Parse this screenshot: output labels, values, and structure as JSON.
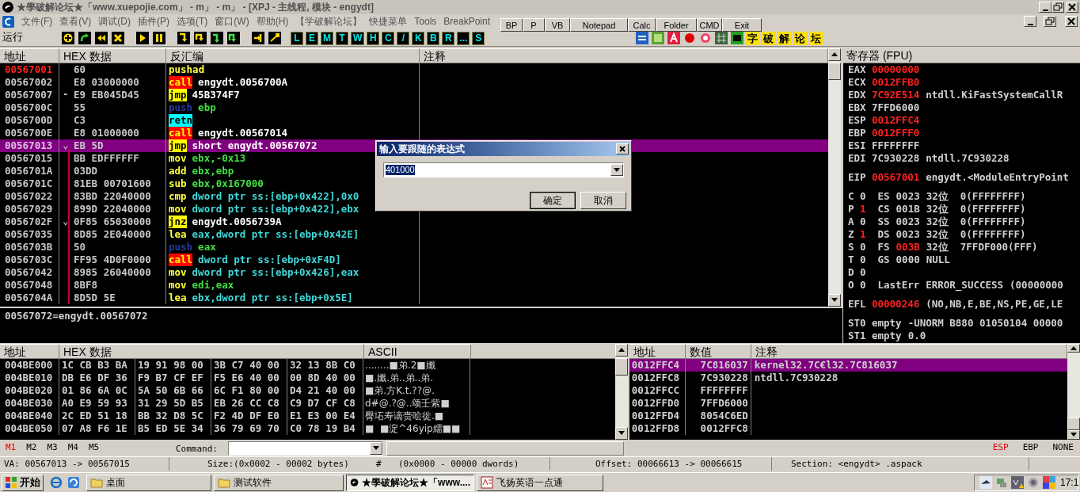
{
  "title_bar": {
    "title": "★學破解论坛★「www.xuepojie.com」 - m」 - m」 - [XPJ - 主线程, 模块 - engydt]"
  },
  "menu": [
    "文件(F)",
    "查看(V)",
    "调试(D)",
    "插件(P)",
    "选项(T)",
    "窗口(W)",
    "帮助(H)",
    "【学破解论坛】",
    "快捷菜单",
    "Tools",
    "BreakPoint"
  ],
  "quick_buttons": [
    "BP",
    "P",
    "VB",
    "Notepad",
    "Calc",
    "Folder",
    "CMD",
    "Exit"
  ],
  "toolbar": {
    "status": "运行",
    "letter_buttons": [
      "L",
      "E",
      "M",
      "T",
      "W",
      "H",
      "C",
      "/",
      "K",
      "B",
      "R",
      "...",
      "S"
    ],
    "text_buttons": [
      "字",
      "破",
      "解",
      "论",
      "坛"
    ]
  },
  "disassembly": {
    "columns": [
      "地址",
      "HEX 数据",
      "反汇编",
      "注释"
    ],
    "rows": [
      {
        "address": "00567001",
        "hex": "60",
        "mnemonic": "pushad",
        "kind": "plain",
        "current": true,
        "selected": false,
        "jump_line": false
      },
      {
        "address": "00567002",
        "hex": "E8 03000000",
        "mnemonic": "call",
        "kind": "call",
        "operands": {
          "text": "engydt.0056700A",
          "kind": "label"
        },
        "current": false,
        "selected": false,
        "jump_line": false
      },
      {
        "address": "00567007",
        "marker": "-",
        "hex": "E9 EB045D45",
        "mnemonic": "jmp",
        "kind": "jump",
        "operands": {
          "text": "45B374F7",
          "kind": "label"
        },
        "current": false,
        "selected": false,
        "jump_line": false
      },
      {
        "address": "0056700C",
        "hex": "55",
        "mnemonic": "push",
        "kind": "push",
        "operands": {
          "text": "ebp",
          "kind": "reg"
        },
        "current": false,
        "selected": false,
        "jump_line": false
      },
      {
        "address": "0056700D",
        "hex": "C3",
        "mnemonic": "retn",
        "kind": "ret",
        "current": false,
        "selected": false,
        "jump_line": false
      },
      {
        "address": "0056700E",
        "hex": "E8 01000000",
        "mnemonic": "call",
        "kind": "call",
        "operands": {
          "text": "engydt.00567014",
          "kind": "label"
        },
        "current": false,
        "selected": false,
        "jump_line": false
      },
      {
        "address": "00567013",
        "marker": "⌄",
        "hex": "EB 5D",
        "mnemonic": "jmp",
        "kind": "jump",
        "operands": {
          "text": "short engydt.00567072",
          "kind": "label"
        },
        "current": false,
        "selected": true,
        "jump_line": true
      },
      {
        "address": "00567015",
        "hex": "BB EDFFFFFF",
        "mnemonic": "mov",
        "kind": "plain",
        "operands": {
          "text": "ebx,-0x13",
          "kind": "reg"
        },
        "current": false,
        "selected": false,
        "jump_line": false
      },
      {
        "address": "0056701A",
        "hex": "03DD",
        "mnemonic": "add",
        "kind": "plain",
        "operands": {
          "text": "ebx,ebp",
          "kind": "reg"
        },
        "current": false,
        "selected": false,
        "jump_line": false
      },
      {
        "address": "0056701C",
        "hex": "81EB 00701600",
        "mnemonic": "sub",
        "kind": "plain",
        "operands": {
          "text": "ebx,0x167000",
          "kind": "reg"
        },
        "current": false,
        "selected": false,
        "jump_line": false
      },
      {
        "address": "00567022",
        "hex": "83BD 22040000",
        "mnemonic": "cmp",
        "kind": "plain",
        "operands": {
          "text": "dword ptr ss:[ebp+0x422],0x0",
          "kind": "mem"
        },
        "current": false,
        "selected": false,
        "jump_line": false
      },
      {
        "address": "00567029",
        "hex": "899D 22040000",
        "mnemonic": "mov",
        "kind": "plain",
        "operands": {
          "text": "dword ptr ss:[ebp+0x422],ebx",
          "kind": "mem"
        },
        "current": false,
        "selected": false,
        "jump_line": false
      },
      {
        "address": "0056702F",
        "marker": "⌄",
        "hex": "0F85 65030000",
        "mnemonic": "jnz",
        "kind": "jump",
        "operands": {
          "text": "engydt.0056739A",
          "kind": "label"
        },
        "current": false,
        "selected": false,
        "jump_line": false
      },
      {
        "address": "00567035",
        "hex": "8D85 2E040000",
        "mnemonic": "lea",
        "kind": "plain",
        "operands": {
          "text": "eax,dword ptr ss:[ebp+0x42E]",
          "kind": "mem"
        },
        "current": false,
        "selected": false,
        "jump_line": false
      },
      {
        "address": "0056703B",
        "hex": "50",
        "mnemonic": "push",
        "kind": "push",
        "operands": {
          "text": "eax",
          "kind": "reg"
        },
        "current": false,
        "selected": false,
        "jump_line": false
      },
      {
        "address": "0056703C",
        "hex": "FF95 4D0F0000",
        "mnemonic": "call",
        "kind": "call",
        "operands": {
          "text": "dword ptr ss:[ebp+0xF4D]",
          "kind": "mem"
        },
        "current": false,
        "selected": false,
        "jump_line": false
      },
      {
        "address": "00567042",
        "hex": "8985 26040000",
        "mnemonic": "mov",
        "kind": "plain",
        "operands": {
          "text": "dword ptr ss:[ebp+0x426],eax",
          "kind": "mem"
        },
        "current": false,
        "selected": false,
        "jump_line": false
      },
      {
        "address": "00567048",
        "hex": "8BF8",
        "mnemonic": "mov",
        "kind": "plain",
        "operands": {
          "text": "edi,eax",
          "kind": "reg"
        },
        "current": false,
        "selected": false,
        "jump_line": false
      },
      {
        "address": "0056704A",
        "hex": "8D5D 5E",
        "mnemonic": "lea",
        "kind": "plain",
        "operands": {
          "text": "ebx,dword ptr ss:[ebp+0x5E]",
          "kind": "mem"
        },
        "current": false,
        "selected": false,
        "jump_line": false
      }
    ]
  },
  "info_line": "00567072=engydt.00567072",
  "registers": {
    "title": "寄存器 (FPU)",
    "groups": [
      [
        {
          "kind": "reg",
          "name": "EAX",
          "value": "00000000",
          "changed": true
        },
        {
          "kind": "reg",
          "name": "ECX",
          "value": "0012FFB0",
          "changed": true
        },
        {
          "kind": "reg",
          "name": "EDX",
          "value": "7C92E514",
          "changed": true,
          "comment": "ntdll.KiFastSystemCallR"
        },
        {
          "kind": "reg",
          "name": "EBX",
          "value": "7FFD6000",
          "changed": false
        },
        {
          "kind": "reg",
          "name": "ESP",
          "value": "0012FFC4",
          "changed": true
        },
        {
          "kind": "reg",
          "name": "EBP",
          "value": "0012FFF0",
          "changed": true
        },
        {
          "kind": "reg",
          "name": "ESI",
          "value": "FFFFFFFF",
          "changed": false
        },
        {
          "kind": "reg",
          "name": "EDI",
          "value": "7C930228",
          "changed": false,
          "comment": "ntdll.7C930228"
        }
      ],
      [
        {
          "kind": "reg",
          "name": "EIP",
          "value": "00567001",
          "changed": true,
          "comment": "engydt.<ModuleEntryPoint"
        }
      ],
      [
        {
          "kind": "flag",
          "name": "C",
          "value": "0",
          "changed": false,
          "segment": {
            "name": "ES",
            "value": "0023",
            "changed": false,
            "info": "32位  0(FFFFFFFF)"
          }
        },
        {
          "kind": "flag",
          "name": "P",
          "value": "1",
          "changed": true,
          "segment": {
            "name": "CS",
            "value": "001B",
            "changed": false,
            "info": "32位  0(FFFFFFFF)"
          }
        },
        {
          "kind": "flag",
          "name": "A",
          "value": "0",
          "changed": false,
          "segment": {
            "name": "SS",
            "value": "0023",
            "changed": false,
            "info": "32位  0(FFFFFFFF)"
          }
        },
        {
          "kind": "flag",
          "name": "Z",
          "value": "1",
          "changed": true,
          "segment": {
            "name": "DS",
            "value": "0023",
            "changed": false,
            "info": "32位  0(FFFFFFFF)"
          }
        },
        {
          "kind": "flag",
          "name": "S",
          "value": "0",
          "changed": false,
          "segment": {
            "name": "FS",
            "value": "003B",
            "changed": true,
            "info": "32位  7FFDF000(FFF)"
          }
        },
        {
          "kind": "flag",
          "name": "T",
          "value": "0",
          "changed": false,
          "segment": {
            "name": "GS",
            "value": "0000",
            "changed": false,
            "info": "NULL"
          }
        },
        {
          "kind": "flag",
          "name": "D",
          "value": "0",
          "changed": false
        },
        {
          "kind": "flag",
          "name": "O",
          "value": "0",
          "changed": false,
          "segment": {
            "name": "LastErr",
            "value": "ERROR_SUCCESS",
            "changed": false,
            "info": "(00000000"
          }
        }
      ],
      [
        {
          "kind": "reg",
          "name": "EFL",
          "value": "00000246",
          "changed": true,
          "comment": "(NO,NB,E,BE,NS,PE,GE,LE"
        }
      ],
      [
        {
          "kind": "reg",
          "name": "ST0",
          "value": "empty",
          "changed": false,
          "comment": "-UNORM B880 01050104 00000"
        },
        {
          "kind": "reg",
          "name": "ST1",
          "value": "empty",
          "changed": false,
          "comment": "0.0"
        }
      ]
    ]
  },
  "dump": {
    "columns": [
      "地址",
      "HEX 数据",
      "ASCII"
    ],
    "rows": [
      {
        "address": "004BE000",
        "hex": [
          "1C CB B3 BA",
          "19 91 98 00",
          "3B C7 40 00",
          "32 13 8B C0"
        ],
        "ascii": "........■弟.2■孅"
      },
      {
        "address": "004BE010",
        "hex": [
          "DB E6 DF 36",
          "F9 B7 CF EF",
          "F5 E6 40 00",
          "00 8D 40 00"
        ],
        "ascii": "■.孅.弟..弟..弟."
      },
      {
        "address": "004BE020",
        "hex": [
          "01 86 6A 0C",
          "5A 50 6B 66",
          "6C F1 80 00",
          "D4 21 40 00"
        ],
        "ascii": "■弟.方K.t.??@."
      },
      {
        "address": "004BE030",
        "hex": [
          "A0 E9 59 93",
          "31 29 5D B5",
          "EB 26 CC C8",
          "C9 D7 CF C8"
        ],
        "ascii": "d#@.?@..颂壬紫■"
      },
      {
        "address": "004BE040",
        "hex": [
          "2C ED 51 18",
          "BB 32 D8 5C",
          "F2 4D DF E0",
          "E1 E3 00 E4"
        ],
        "ascii": "臀坧寿谪赍哙徙.■"
      },
      {
        "address": "004BE050",
        "hex": [
          "07 A8 F6 1E",
          "B5 ED 5E 34",
          "36 79 69 70",
          "C0 78 19 B4"
        ],
        "ascii": "■  ■淀^46yip繻■■"
      }
    ]
  },
  "stack": {
    "columns": [
      "地址",
      "数值",
      "注释"
    ],
    "rows": [
      {
        "address": "0012FFC4",
        "value": "7C816037",
        "comment": "kernel32.7C€l32.7C816037",
        "selected": true
      },
      {
        "address": "0012FFC8",
        "value": "7C930228",
        "comment": "ntdll.7C930228",
        "selected": false
      },
      {
        "address": "0012FFCC",
        "value": "FFFFFFFF",
        "selected": false
      },
      {
        "address": "0012FFD0",
        "value": "7FFD6000",
        "selected": false
      },
      {
        "address": "0012FFD4",
        "value": "8054C6ED",
        "selected": false
      },
      {
        "address": "0012FFD8",
        "value": "0012FFC8",
        "selected": false
      }
    ]
  },
  "memory_tabs": [
    {
      "label": "M1",
      "selected": true
    },
    {
      "label": "M2",
      "selected": false
    },
    {
      "label": "M3",
      "selected": false
    },
    {
      "label": "M4",
      "selected": false
    },
    {
      "label": "M5",
      "selected": false
    }
  ],
  "command": {
    "label": "Command:"
  },
  "stack_modes": [
    {
      "label": "ESP",
      "selected": true
    },
    {
      "label": "EBP",
      "selected": false
    },
    {
      "label": "NONE",
      "selected": false
    }
  ],
  "status_bar": [
    "VA: 00567013 -> 00567015",
    "Size:(0x0002 - 00002 bytes)",
    "#",
    "(0x0000 - 00000 dwords)",
    "Offset: 00066613 -> 00066615",
    "Section: <engydt> .aspack"
  ],
  "dialog": {
    "title": "输入要跟随的表达式",
    "value": "401000",
    "buttons": [
      "确定",
      "取消"
    ]
  },
  "taskbar": {
    "start": "开始",
    "tasks": [
      {
        "label": "桌面",
        "kind": "folder",
        "selected": false
      },
      {
        "label": "测试软件",
        "kind": "folder",
        "selected": false
      },
      {
        "label": "★學破解论坛★「www....",
        "kind": "debugger",
        "selected": true
      },
      {
        "label": "飞扬英语一点通",
        "kind": "app",
        "selected": false
      }
    ],
    "clock": "17:1"
  }
}
